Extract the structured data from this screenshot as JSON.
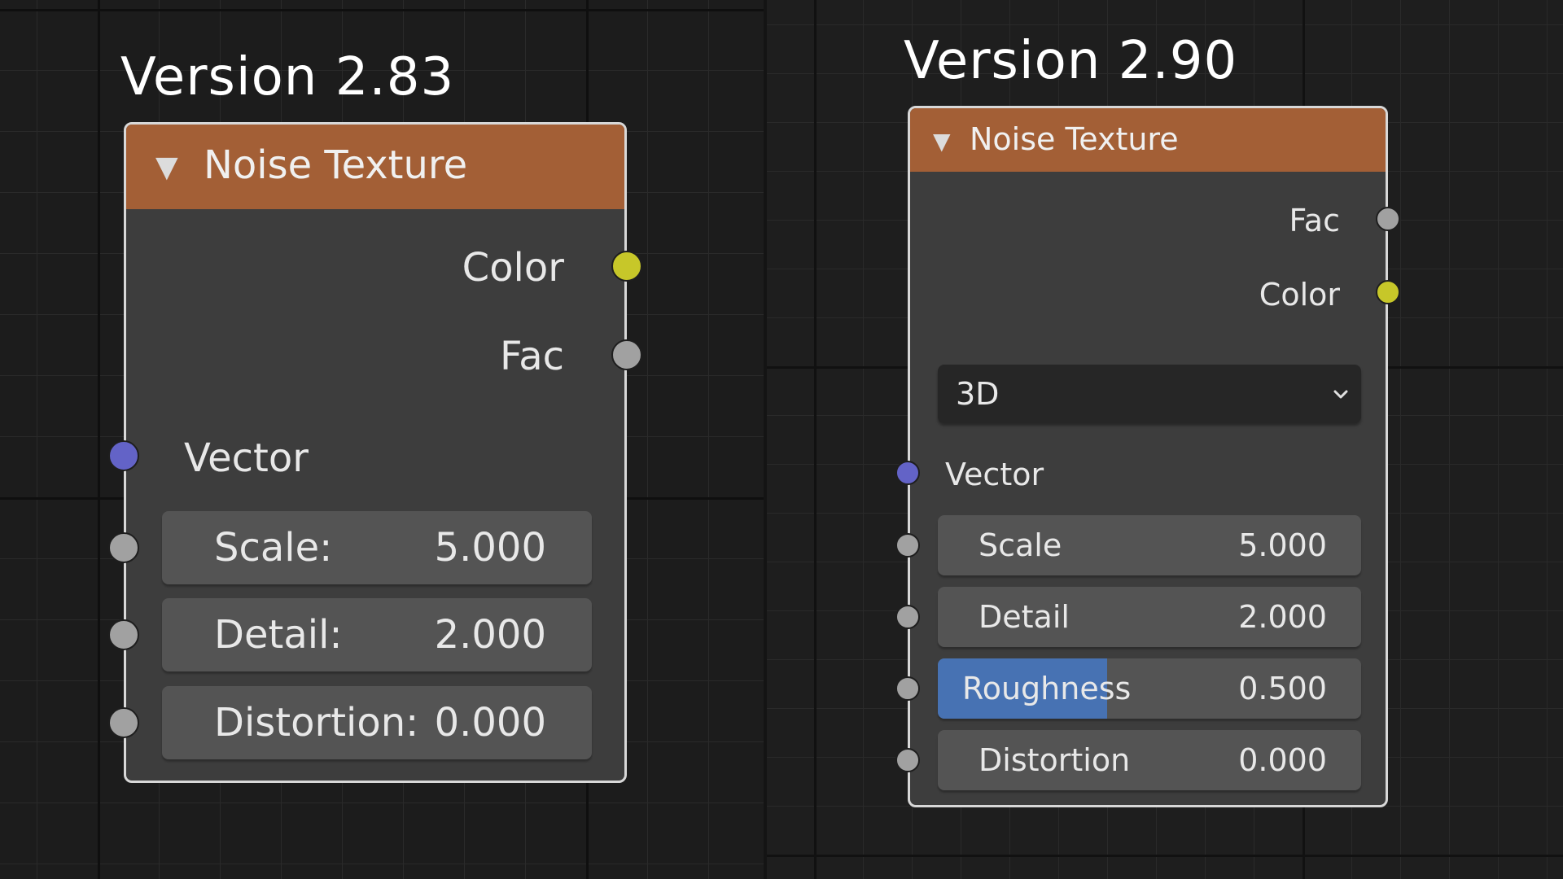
{
  "left_panel": {
    "title": "Version 2.83",
    "node": {
      "title": "Noise Texture",
      "outputs": [
        {
          "label": "Color",
          "socket": "yellow"
        },
        {
          "label": "Fac",
          "socket": "gray"
        }
      ],
      "vector_label": "Vector",
      "fields": [
        {
          "label": "Scale:",
          "value": "5.000"
        },
        {
          "label": "Detail:",
          "value": "2.000"
        },
        {
          "label": "Distortion:",
          "value": "0.000"
        }
      ]
    }
  },
  "right_panel": {
    "title": "Version 2.90",
    "node": {
      "title": "Noise Texture",
      "outputs": [
        {
          "label": "Fac",
          "socket": "gray"
        },
        {
          "label": "Color",
          "socket": "yellow"
        }
      ],
      "dimension": "3D",
      "vector_label": "Vector",
      "fields": [
        {
          "label": "Scale",
          "value": "5.000"
        },
        {
          "label": "Detail",
          "value": "2.000"
        },
        {
          "label": "Roughness",
          "value": "0.500",
          "fill_fraction": 0.4
        },
        {
          "label": "Distortion",
          "value": "0.000"
        }
      ]
    }
  },
  "colors": {
    "header": "#a35f36",
    "node_body": "#3d3d3d",
    "field": "#545454",
    "slider_fill": "#4772b3",
    "socket_yellow": "#c7c729",
    "socket_gray": "#a1a1a1",
    "socket_blue": "#6363c7"
  }
}
